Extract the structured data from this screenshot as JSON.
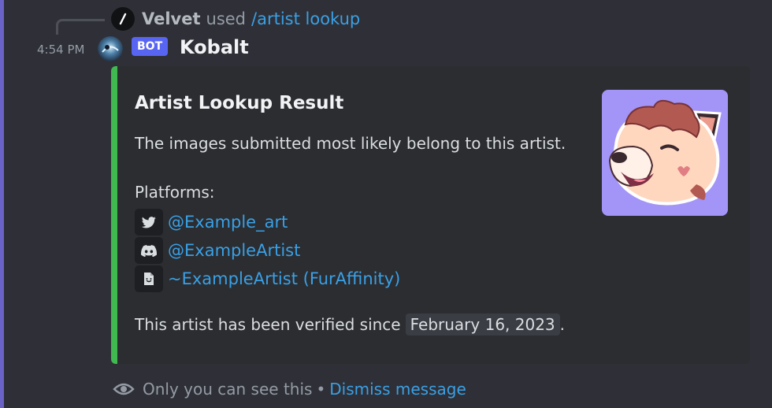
{
  "command": {
    "user": "Velvet",
    "used_text": "used",
    "name": "/artist lookup"
  },
  "message": {
    "timestamp": "4:54 PM",
    "bot_tag": "BOT",
    "author": "Kobalt"
  },
  "embed": {
    "accent_color": "#3fb950",
    "title": "Artist Lookup Result",
    "description": "The images submitted most likely belong to this artist.",
    "platforms_label": "Platforms:",
    "platforms": [
      {
        "icon": "twitter-icon",
        "text": "@Example_art"
      },
      {
        "icon": "discord-icon",
        "text": "@ExampleArtist"
      },
      {
        "icon": "furaffinity-icon",
        "text": "~ExampleArtist (FurAffinity)"
      }
    ],
    "verified_prefix": "This artist has been verified since",
    "verified_date": "February 16, 2023",
    "verified_suffix": "."
  },
  "footer": {
    "visibility_text": "Only you can see this",
    "separator": "•",
    "dismiss_label": "Dismiss message"
  }
}
